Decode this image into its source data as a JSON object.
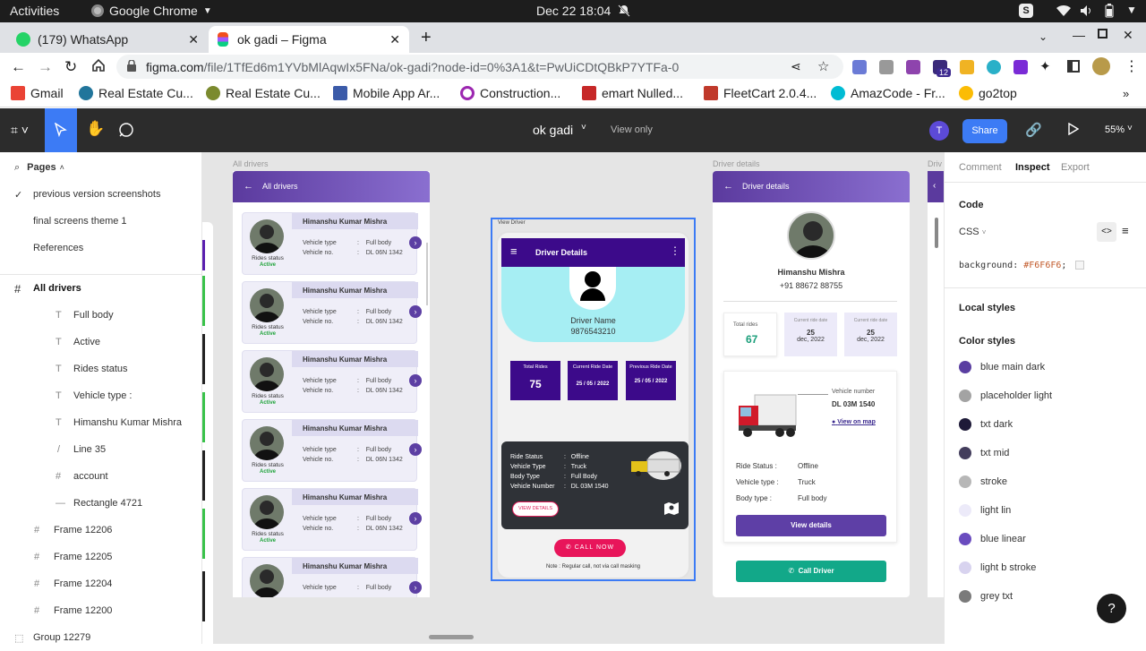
{
  "system": {
    "activities": "Activities",
    "app": "Google Chrome",
    "datetime": "Dec 22  18:04"
  },
  "tabs": [
    {
      "title": "(179) WhatsApp"
    },
    {
      "title": "ok gadi – Figma"
    }
  ],
  "address": {
    "host": "figma.com",
    "path": "/file/1TfEd6m1YVbMlAqwIx5FNa/ok-gadi?node-id=0%3A1&t=PwUiCDtQBkP7YTFa-0"
  },
  "extensions": {
    "badge": "12"
  },
  "bookmarks": [
    {
      "label": "Gmail",
      "color": "#ea4335"
    },
    {
      "label": "Real Estate Cu...",
      "color": "#21759b"
    },
    {
      "label": "Real Estate Cu...",
      "color": "#7b8a2e"
    },
    {
      "label": "Mobile App Ar...",
      "color": "#3b5ba9"
    },
    {
      "label": "Construction...",
      "color": "#9c27b0"
    },
    {
      "label": "emart Nulled...",
      "color": "#c62828"
    },
    {
      "label": "FleetCart 2.0.4...",
      "color": "#c0392b"
    },
    {
      "label": "AmazCode - Fr...",
      "color": "#00bcd4"
    },
    {
      "label": "go2top",
      "color": "#fbbc05"
    }
  ],
  "figma": {
    "file_name": "ok gadi",
    "view_only": "View only",
    "avatar_letter": "T",
    "share": "Share",
    "zoom": "55%"
  },
  "left_panel": {
    "pages_label": "Pages",
    "pages": [
      "previous version screenshots",
      "final screens theme 1",
      "References"
    ],
    "layers": [
      {
        "name": "All drivers",
        "type": "frame"
      },
      {
        "name": "Full body",
        "type": "text"
      },
      {
        "name": "Active",
        "type": "text"
      },
      {
        "name": "Rides status",
        "type": "text"
      },
      {
        "name": "Vehicle type :",
        "type": "text"
      },
      {
        "name": "Himanshu Kumar Mishra",
        "type": "text"
      },
      {
        "name": "Line 35",
        "type": "line"
      },
      {
        "name": "account",
        "type": "frame"
      },
      {
        "name": "Rectangle 4721",
        "type": "rect"
      },
      {
        "name": "Frame 12206",
        "type": "frame"
      },
      {
        "name": "Frame 12205",
        "type": "frame"
      },
      {
        "name": "Frame 12204",
        "type": "frame"
      },
      {
        "name": "Frame 12200",
        "type": "frame"
      },
      {
        "name": "Group 12279",
        "type": "group"
      }
    ]
  },
  "canvas": {
    "frame_labels": {
      "all_drivers": "All drivers",
      "driver_details": "Driver details",
      "view_driver": "View Driver",
      "partial": "Driv"
    },
    "all_drivers": {
      "header": "All drivers",
      "cards": [
        {
          "name": "Himanshu Kumar Mishra",
          "rides_status": "Rides status",
          "status": "Active",
          "vehicle_type_label": "Vehicle type",
          "vehicle_type": "Full body",
          "vehicle_no_label": "Vehicle no.",
          "vehicle_no": "DL 06N 1342"
        },
        {
          "name": "Himanshu Kumar Mishra",
          "rides_status": "Rides status",
          "status": "Active",
          "vehicle_type_label": "Vehicle type",
          "vehicle_type": "Full body",
          "vehicle_no_label": "Vehicle no.",
          "vehicle_no": "DL 06N 1342"
        },
        {
          "name": "Himanshu Kumar Mishra",
          "rides_status": "Rides status",
          "status": "Active",
          "vehicle_type_label": "Vehicle type",
          "vehicle_type": "Full body",
          "vehicle_no_label": "Vehicle no.",
          "vehicle_no": "DL 06N 1342"
        },
        {
          "name": "Himanshu Kumar Mishra",
          "rides_status": "Rides status",
          "status": "Active",
          "vehicle_type_label": "Vehicle type",
          "vehicle_type": "Full body",
          "vehicle_no_label": "Vehicle no.",
          "vehicle_no": "DL 06N 1342"
        },
        {
          "name": "Himanshu Kumar Mishra",
          "rides_status": "Rides status",
          "status": "Active",
          "vehicle_type_label": "Vehicle type",
          "vehicle_type": "Full body",
          "vehicle_no_label": "Vehicle no.",
          "vehicle_no": "DL 06N 1342"
        },
        {
          "name": "Himanshu Kumar Mishra",
          "rides_status": "",
          "status": "",
          "vehicle_type_label": "Vehicle type",
          "vehicle_type": "Full body",
          "vehicle_no_label": "Vehicle no.",
          "vehicle_no": ""
        }
      ]
    },
    "view_driver": {
      "header": "Driver Details",
      "driver_name": "Driver Name",
      "phone": "9876543210",
      "stats": [
        {
          "label": "Total Rides",
          "value": "75"
        },
        {
          "label": "Current Ride Date",
          "value": "25 / 05 / 2022"
        },
        {
          "label": "Previous Ride Date",
          "value": "25 / 05 / 2022"
        }
      ],
      "ride_rows": [
        {
          "label": "Ride Status",
          "value": "Offline"
        },
        {
          "label": "Vehicle Type",
          "value": "Truck"
        },
        {
          "label": "Body Type",
          "value": "Full Body"
        },
        {
          "label": "Vehicle Number",
          "value": "DL 03M 1540"
        }
      ],
      "view_details": "VIEW DETAILS",
      "call_now": "CALL NOW",
      "note": "Note : Regular call, not via call masking"
    },
    "driver_details": {
      "header": "Driver details",
      "name": "Himanshu Mishra",
      "phone": "+91 88672 88755",
      "stats": [
        {
          "label": "Total rides",
          "value": "67",
          "sub": ""
        },
        {
          "label": "Current ride date",
          "value": "25",
          "sub": "dec, 2022"
        },
        {
          "label": "Current ride date",
          "value": "25",
          "sub": "dec, 2022"
        }
      ],
      "vehicle_number_label": "Vehicle number",
      "vehicle_number": "DL 03M 1540",
      "view_on_map": "View on map",
      "rows": [
        {
          "label": "Ride Status :",
          "value": "Offline"
        },
        {
          "label": "Vehicle type :",
          "value": "Truck"
        },
        {
          "label": "Body type :",
          "value": "Full body"
        }
      ],
      "view_details": "View details",
      "call_driver": "Call Driver"
    }
  },
  "right_panel": {
    "tabs": [
      "Comment",
      "Inspect",
      "Export"
    ],
    "code_label": "Code",
    "lang": "CSS",
    "code_prop": "background: ",
    "code_value": "#F6F6F6",
    "code_end": ";",
    "local_styles": "Local styles",
    "color_styles_label": "Color styles",
    "color_styles": [
      {
        "name": "blue main dark",
        "color": "#5a3ea1"
      },
      {
        "name": "placeholder light",
        "color": "#a3a3a3"
      },
      {
        "name": "txt dark",
        "color": "#1e1a38"
      },
      {
        "name": "txt mid",
        "color": "#433d5c"
      },
      {
        "name": "stroke",
        "color": "#b7b7b7"
      },
      {
        "name": "light lin",
        "color": "#eceaf9"
      },
      {
        "name": "blue linear",
        "color": "#6a4cbf"
      },
      {
        "name": "light b stroke",
        "color": "#d8d3ef"
      },
      {
        "name": "grey txt",
        "color": "#7a7a7a"
      }
    ],
    "help": "?"
  }
}
